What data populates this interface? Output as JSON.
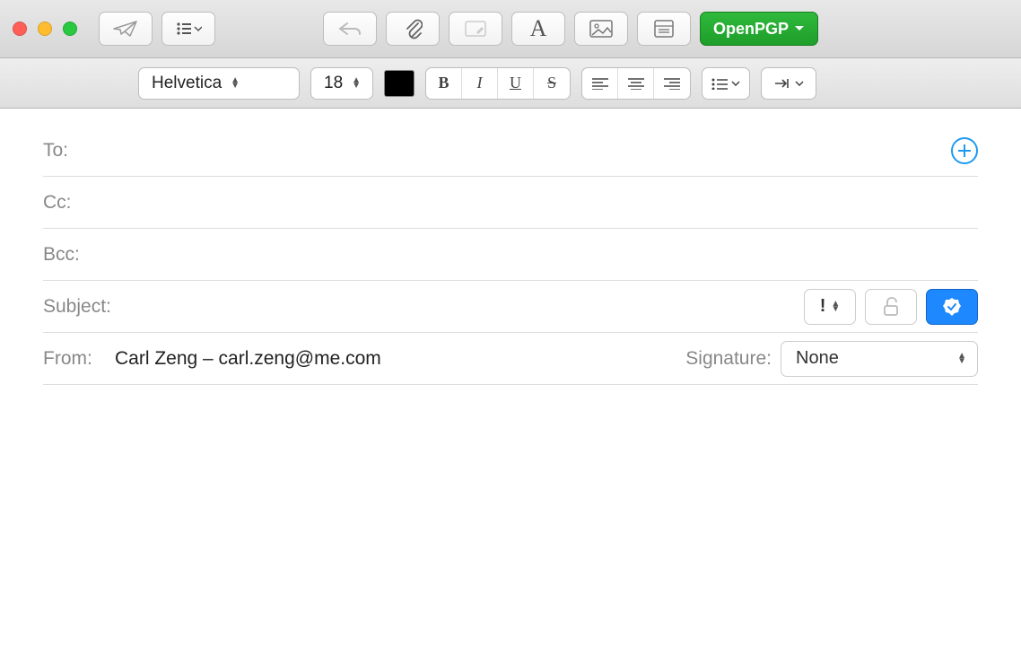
{
  "toolbar": {
    "openpgp_label": "OpenPGP"
  },
  "format": {
    "font_family": "Helvetica",
    "font_size": "18"
  },
  "compose": {
    "to_label": "To:",
    "cc_label": "Cc:",
    "bcc_label": "Bcc:",
    "subject_label": "Subject:",
    "from_label": "From:",
    "from_value": "Carl Zeng – carl.zeng@me.com",
    "signature_label": "Signature:",
    "signature_value": "None",
    "priority_symbol": "!"
  }
}
